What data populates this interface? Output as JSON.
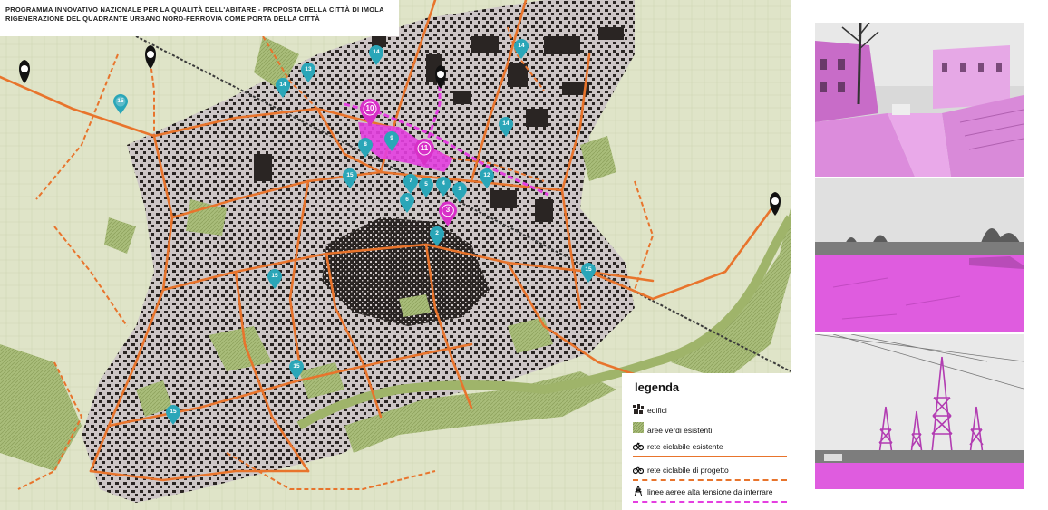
{
  "title": {
    "line1": "PROGRAMMA INNOVATIVO NAZIONALE PER LA QUALITÀ DELL'ABITARE - PROPOSTA DELLA CITTÀ DI IMOLA",
    "line2": "RIGENERAZIONE DEL QUADRANTE URBANO NORD-FERROVIA COME PORTA DELLA CITTÀ"
  },
  "colors": {
    "background_map": "#dfe4c8",
    "built_area": "#c9c2c2",
    "buildings": "#2a2523",
    "green": "#a9bd7a",
    "cycle_existing": "#e8742c",
    "cycle_project": "#e8742c",
    "power_lines": "#e43fe0",
    "pin_cyan": "#2aa6b8",
    "pin_magenta": "#d830c8",
    "pin_black": "#111111"
  },
  "pins": {
    "cyan": [
      "15",
      "13",
      "14",
      "14",
      "14",
      "14",
      "15",
      "15",
      "15",
      "15",
      "15",
      "12",
      "1",
      "2",
      "4",
      "5",
      "6",
      "7",
      "8",
      "9"
    ],
    "magenta": [
      "10",
      "11",
      "3"
    ]
  },
  "legend": {
    "title": "legenda",
    "items": [
      {
        "label": "edifici",
        "icon": "buildings-icon"
      },
      {
        "label": "aree verdi esistenti",
        "icon": "green-area-icon"
      },
      {
        "label": "rete ciclabile esistente",
        "icon": "bicycle-icon"
      },
      {
        "label": "rete ciclabile di progetto",
        "icon": "bicycle-icon"
      },
      {
        "label": "linee aeree alta tensione da interrare",
        "icon": "pylon-icon"
      }
    ]
  },
  "photos": [
    {
      "name": "photo-street-garages",
      "description_icon": "street-photo"
    },
    {
      "name": "photo-empty-lot",
      "description_icon": "lot-photo"
    },
    {
      "name": "photo-power-pylons",
      "description_icon": "pylon-photo"
    }
  ]
}
